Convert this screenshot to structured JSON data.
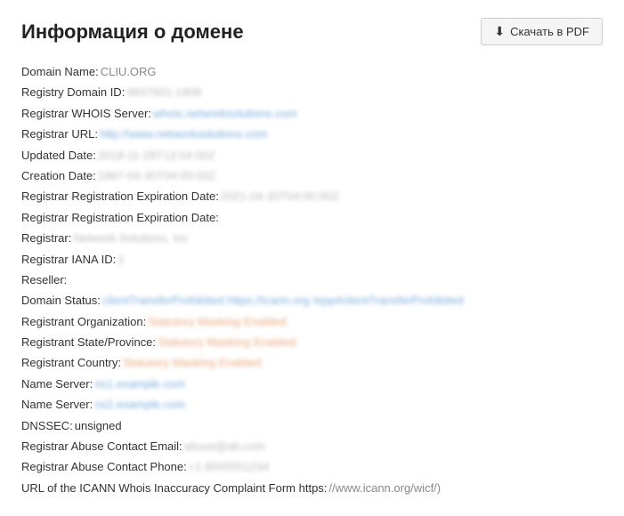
{
  "header": {
    "title": "Информация о домене",
    "pdf_button_label": "Скачать в PDF"
  },
  "whois": {
    "rows": [
      {
        "label": "Domain Name:",
        "value": "CLIU.ORG",
        "style": "normal"
      },
      {
        "label": "Registry Domain ID:",
        "value": "8837651-1808",
        "style": "blurred"
      },
      {
        "label": "Registrar WHOIS Server:",
        "value": "whois.networksolutions.com",
        "style": "link-blurred"
      },
      {
        "label": "Registrar URL:",
        "value": "http://www.networksolutions.com",
        "style": "link-blurred"
      },
      {
        "label": "Updated Date:",
        "value": "2018-11-28T13:54:00Z",
        "style": "blurred"
      },
      {
        "label": "Creation Date:",
        "value": "1997-04-30T04:00:00Z",
        "style": "blurred"
      },
      {
        "label": "Registrar Registration Expiration Date:",
        "value": "2021-04-30T04:00:00Z",
        "style": "blurred"
      },
      {
        "label": "Registrar Registration Expiration Date:",
        "value": "",
        "style": "normal"
      },
      {
        "label": "Registrar:",
        "value": "Network Solutions, Inc",
        "style": "blurred"
      },
      {
        "label": "Registrar IANA ID:",
        "value": "2",
        "style": "blurred"
      },
      {
        "label": "Reseller:",
        "value": "",
        "style": "normal"
      },
      {
        "label": "Domain Status:",
        "value": "clientTransferProhibited https://icann.org /epp#clientTransferProhibited",
        "style": "link-blurred"
      },
      {
        "label": "Registrant Organization:",
        "value": "Statutory Masking Enabled",
        "style": "orange-blurred"
      },
      {
        "label": "Registrant State/Province:",
        "value": "Statutory Masking Enabled",
        "style": "orange-blurred"
      },
      {
        "label": "Registrant Country:",
        "value": "Statutory Masking Enabled",
        "style": "orange-blurred"
      },
      {
        "label": "Name Server:",
        "value": "ns1.example.com",
        "style": "link-blurred"
      },
      {
        "label": "Name Server:",
        "value": "ns2.example.com",
        "style": "link-blurred"
      },
      {
        "label": "DNSSEC:",
        "value": "unsigned",
        "style": "unsigned"
      },
      {
        "label": "Registrar Abuse Contact Email:",
        "value": "abuse@ab.com",
        "style": "blurred"
      },
      {
        "label": "Registrar Abuse Contact Phone:",
        "value": "+1.8005551234",
        "style": "blurred"
      },
      {
        "label": "URL of the ICANN Whois Inaccuracy Complaint Form https:",
        "value": "//www.icann.org/wicf/)",
        "style": "normal"
      }
    ]
  }
}
